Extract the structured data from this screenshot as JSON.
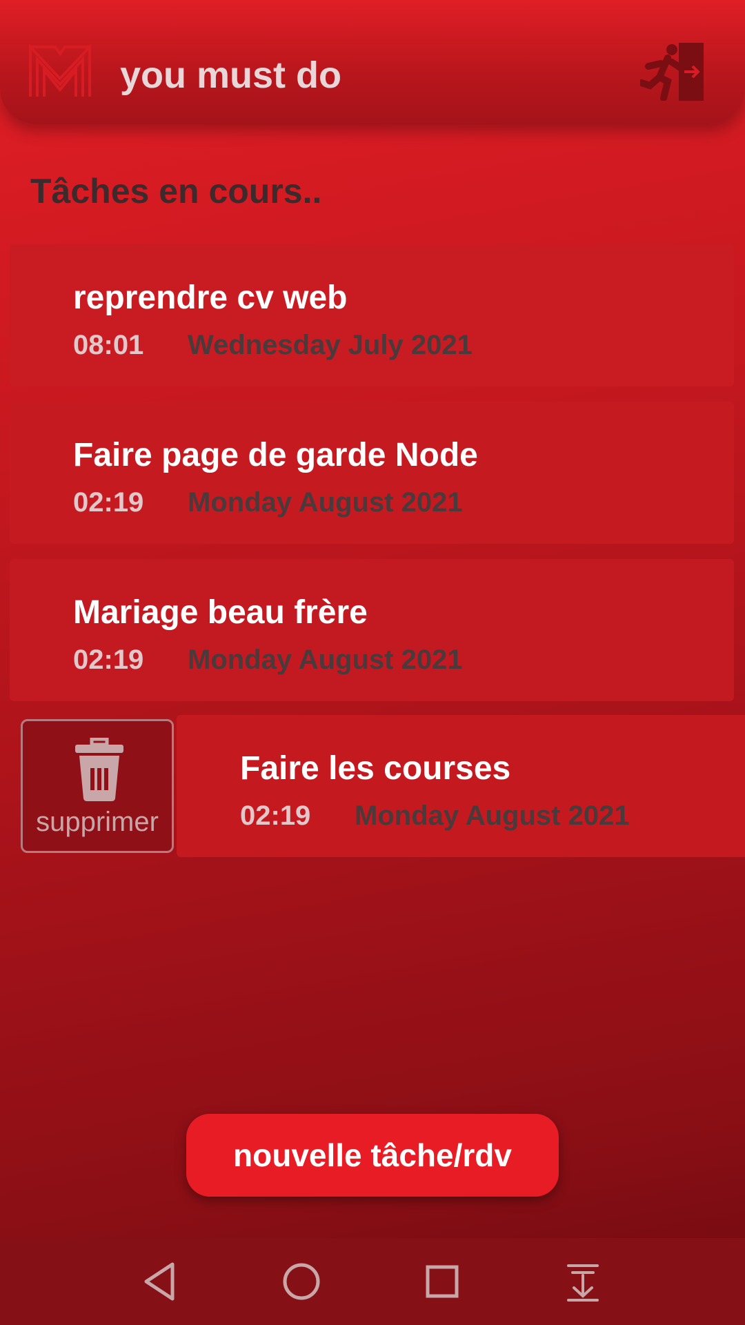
{
  "header": {
    "app_title": "you must do",
    "logo_icon": "m-logo-icon",
    "exit_icon": "exit-door-icon"
  },
  "section_title": "Tâches en cours..",
  "tasks": [
    {
      "name": "reprendre cv web",
      "time": "08:01",
      "date": "Wednesday July 2021"
    },
    {
      "name": "Faire page de garde Node",
      "time": "02:19",
      "date": "Monday August 2021"
    },
    {
      "name": "Mariage beau frère",
      "time": "02:19",
      "date": "Monday August 2021"
    },
    {
      "name": "Faire les courses",
      "time": "02:19",
      "date": "Monday August 2021"
    }
  ],
  "swipe_action": {
    "label": "supprimer",
    "icon": "trash-icon"
  },
  "new_task_button": "nouvelle tâche/rdv",
  "navbar": {
    "icons": [
      "back-icon",
      "home-icon",
      "recents-icon",
      "notification-pull-icon"
    ]
  },
  "colors": {
    "accent": "#e81c24",
    "header": "#b8161c",
    "card": "#c81b22",
    "title_text": "#e8d6d8",
    "date_text": "#4a3a3c"
  }
}
